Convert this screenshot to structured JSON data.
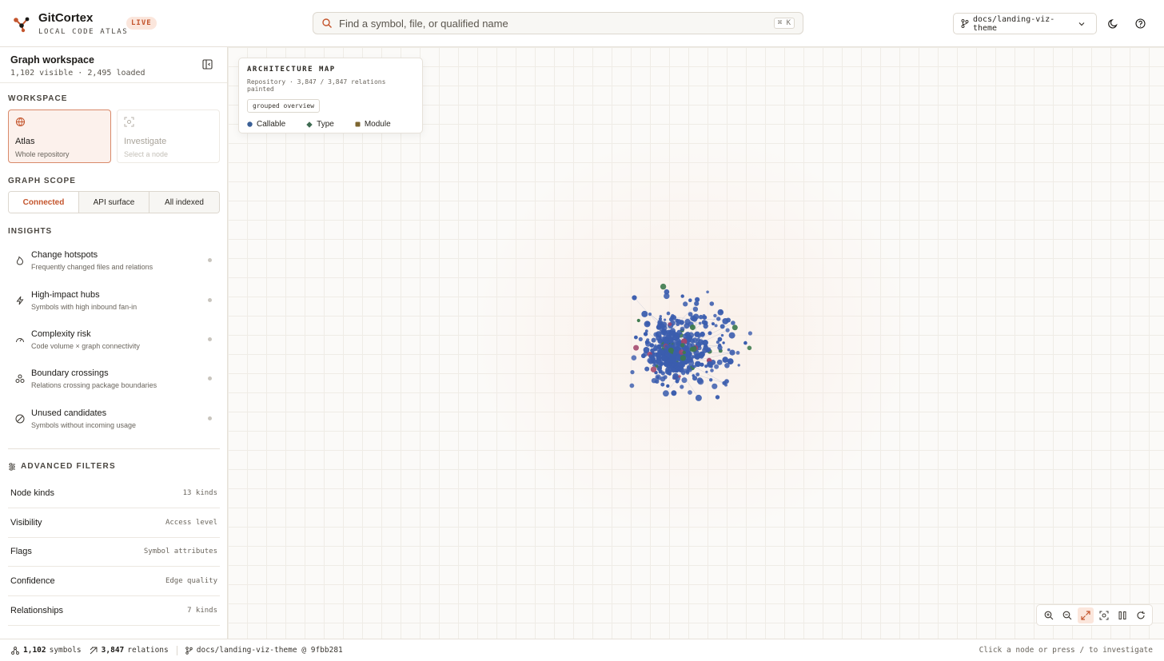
{
  "header": {
    "app_title": "GitCortex",
    "app_subtitle": "LOCAL CODE ATLAS",
    "live_badge": "LIVE",
    "search_placeholder": "Find a symbol, file, or qualified name",
    "search_shortcut": "⌘ K",
    "branch": "docs/landing-viz-theme"
  },
  "sidebar": {
    "title": "Graph workspace",
    "subtitle": "1,102 visible · 2,495 loaded",
    "workspace_label": "WORKSPACE",
    "workspace_cards": [
      {
        "name": "Atlas",
        "desc": "Whole repository",
        "icon": "atlas-icon",
        "state": "active"
      },
      {
        "name": "Investigate",
        "desc": "Select a node",
        "icon": "investigate-icon",
        "state": "disabled"
      }
    ],
    "scope_label": "GRAPH SCOPE",
    "scope_options": [
      "Connected",
      "API surface",
      "All indexed"
    ],
    "scope_selected": "Connected",
    "insights_label": "INSIGHTS",
    "insights": [
      {
        "name": "Change hotspots",
        "desc": "Frequently changed files and relations",
        "icon": "flame-icon"
      },
      {
        "name": "High-impact hubs",
        "desc": "Symbols with high inbound fan-in",
        "icon": "lightning-icon"
      },
      {
        "name": "Complexity risk",
        "desc": "Code volume × graph connectivity",
        "icon": "gauge-icon"
      },
      {
        "name": "Boundary crossings",
        "desc": "Relations crossing package boundaries",
        "icon": "boundary-icon"
      },
      {
        "name": "Unused candidates",
        "desc": "Symbols without incoming usage",
        "icon": "unused-icon"
      }
    ],
    "advanced_label": "ADVANCED FILTERS",
    "filters": [
      {
        "name": "Node kinds",
        "value": "13 kinds"
      },
      {
        "name": "Visibility",
        "value": "Access level"
      },
      {
        "name": "Flags",
        "value": "Symbol attributes"
      },
      {
        "name": "Confidence",
        "value": "Edge quality"
      },
      {
        "name": "Relationships",
        "value": "7 kinds"
      }
    ]
  },
  "canvas": {
    "card_title": "ARCHITECTURE MAP",
    "card_meta": "Repository · 3,847 / 3,847 relations painted",
    "card_chip": "grouped overview",
    "legend": [
      {
        "label": "Callable",
        "color": "#3a5f96",
        "shape": "circle"
      },
      {
        "label": "Type",
        "color": "#3f6b52",
        "shape": "diamond"
      },
      {
        "label": "Module",
        "color": "#7d6630",
        "shape": "square"
      }
    ],
    "node_colors": {
      "callable": "#3b5dae",
      "type": "#3e7a4e",
      "module": "#a2456b"
    }
  },
  "zoom_controls": [
    "zoom-in-icon",
    "zoom-out-icon",
    "expand-icon",
    "focus-icon",
    "pause-icon",
    "reset-icon"
  ],
  "status": {
    "symbols_count": "1,102",
    "symbols_label": "symbols",
    "relations_count": "3,847",
    "relations_label": "relations",
    "branch_ref": "docs/landing-viz-theme @ 9fbb281",
    "hint": "Click a node or press / to investigate"
  },
  "colors": {
    "accent": "#c4552d",
    "callable": "#3b5dae",
    "type": "#3e7a4e",
    "module": "#7d6630"
  }
}
